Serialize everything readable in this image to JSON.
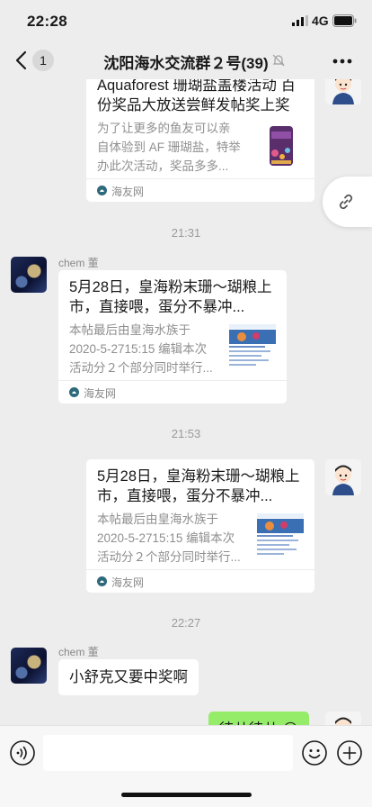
{
  "status": {
    "time": "22:28",
    "network": "4G"
  },
  "nav": {
    "unread_count": "1",
    "title": "沈阳海水交流群２号(39)"
  },
  "messages": {
    "card1": {
      "title": "Aquaforest 珊瑚盐盖楼活动 百份奖品大放送尝鲜发帖奖上奖",
      "desc": "为了让更多的鱼友可以亲自体验到 AF 珊瑚盐，特举办此次活动，奖品多多...",
      "source": "海友网"
    },
    "time1": "21:31",
    "sender1": "chem 董",
    "card2": {
      "title": "5月28日，皇海粉末珊～瑚粮上市，直接喂，蛋分不暴冲...",
      "desc": "本帖最后由皇海水族于 2020-5-2715:15 编辑本次活动分２个部分同时举行...",
      "source": "海友网"
    },
    "time2": "21:53",
    "card3": {
      "title": "5月28日，皇海粉末珊～瑚粮上市，直接喂，蛋分不暴冲...",
      "desc": "本帖最后由皇海水族于 2020-5-2715:15 编辑本次活动分２个部分同时举行...",
      "source": "海友网"
    },
    "time3": "22:27",
    "sender2": "chem 董",
    "text1": "小舒克又要中奖啊",
    "text2": "徒儿徒儿 😊"
  },
  "colors": {
    "background": "#ededed",
    "outgoing_bubble": "#95ec69",
    "source_icon": "#2e6a7a"
  },
  "icons": [
    "signal-icon",
    "battery-icon",
    "back-icon",
    "mute-icon",
    "more-icon",
    "link-icon",
    "voice-icon",
    "emoji-icon",
    "plus-icon"
  ]
}
